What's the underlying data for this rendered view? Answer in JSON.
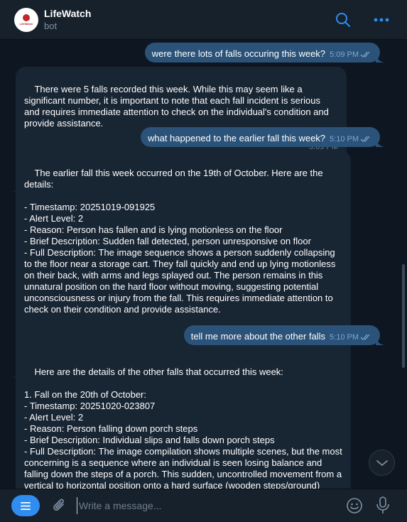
{
  "header": {
    "name": "LifeWatch",
    "status": "bot",
    "avatar_text": "LifeWatch"
  },
  "messages": [
    {
      "dir": "out",
      "text": "were there lots of falls occuring this week?",
      "time": "5:09 PM"
    },
    {
      "dir": "in",
      "text": "There were 5 falls recorded this week. While this may seem like a significant number, it is important to note that each fall incident is serious and requires immediate attention to check on the individual's condition and provide assistance.",
      "time": "5:09 PM"
    },
    {
      "dir": "out",
      "text": "what happened to the earlier fall this week?",
      "time": "5:10 PM"
    },
    {
      "dir": "in",
      "text": "The earlier fall this week occurred on the 19th of October. Here are the details:\n\n- Timestamp: 20251019-091925\n- Alert Level: 2\n- Reason: Person has fallen and is lying motionless on the floor\n- Brief Description: Sudden fall detected, person unresponsive on floor\n- Full Description: The image sequence shows a person suddenly collapsing to the floor near a storage cart. They fall quickly and end up lying motionless on their back, with arms and legs splayed out. The person remains in this unnatural position on the hard floor without moving, suggesting potential unconsciousness or injury from the fall. This requires immediate attention to check on their condition and provide assistance.",
      "time": "5:10 PM"
    },
    {
      "dir": "out",
      "text": "tell me more about the other falls",
      "time": "5:10 PM"
    },
    {
      "dir": "in",
      "text": "Here are the details of the other falls that occurred this week:\n\n1. Fall on the 20th of October:\n- Timestamp: 20251020-023807\n- Alert Level: 2\n- Reason: Person falling down porch steps\n- Brief Description: Individual slips and falls down porch steps\n- Full Description: The image compilation shows multiple scenes, but the most concerning is a sequence where an individual is seen losing balance and falling down the steps of a porch. This sudden, uncontrolled movement from a vertical to horizontal position onto a hard surface (wooden steps/ground) meets critical fall detection criteria. The person",
      "time": ""
    }
  ],
  "composer": {
    "placeholder": "Write a message..."
  },
  "icons": [
    "search-icon",
    "more-icon",
    "menu-icon",
    "paperclip-icon",
    "emoji-icon",
    "microphone-icon",
    "chevron-down-icon",
    "double-check-icon"
  ],
  "colors": {
    "background": "#0e1621",
    "panel": "#17212b",
    "outgoing_bubble": "#2b5278",
    "incoming_bubble": "#182533",
    "accent": "#2f8cf0"
  }
}
